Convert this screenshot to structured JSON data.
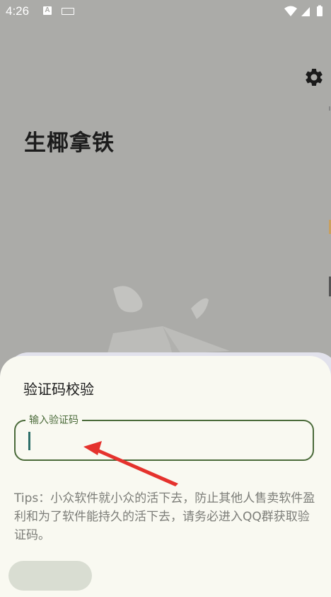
{
  "status_bar": {
    "time": "4:26",
    "a_icon": "A"
  },
  "app": {
    "title": "生椰拿铁"
  },
  "dialog": {
    "title": "验证码校验",
    "input_label": "输入验证码",
    "input_value": "",
    "tips": "Tips：小众软件就小众的活下去，防止其他人售卖软件盈利和为了软件能持久的活下去，请务必进入QQ群获取验证码。",
    "confirm_label": ""
  },
  "colors": {
    "field_border": "#4b6b3a",
    "annotation_arrow": "#e5322d",
    "sheet_background": "#f9f9f1",
    "screen_dim": "#ababa8"
  }
}
